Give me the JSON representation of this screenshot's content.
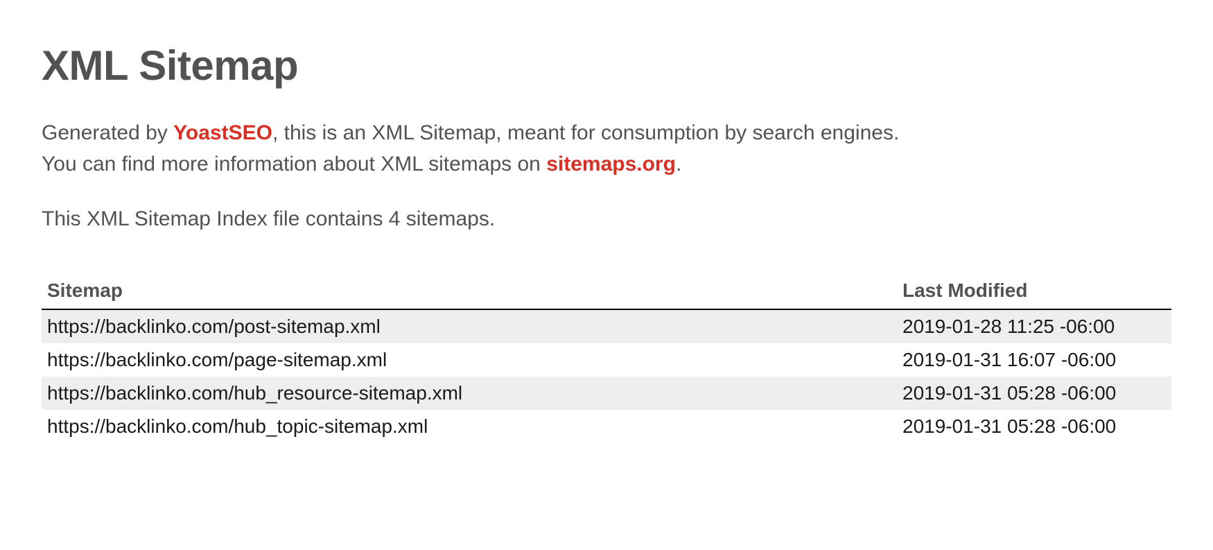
{
  "header": {
    "title": "XML Sitemap",
    "intro_prefix": "Generated by ",
    "yoast_link": "YoastSEO",
    "intro_mid1": ", this is an XML Sitemap, meant for consumption by search engines.",
    "intro_line2_prefix": "You can find more information about XML sitemaps on ",
    "sitemaps_link": "sitemaps.org",
    "intro_line2_suffix": ".",
    "count_line": "This XML Sitemap Index file contains 4 sitemaps."
  },
  "table": {
    "headers": {
      "sitemap": "Sitemap",
      "last_modified": "Last Modified"
    },
    "rows": [
      {
        "url": "https://backlinko.com/post-sitemap.xml",
        "modified": "2019-01-28 11:25 -06:00"
      },
      {
        "url": "https://backlinko.com/page-sitemap.xml",
        "modified": "2019-01-31 16:07 -06:00"
      },
      {
        "url": "https://backlinko.com/hub_resource-sitemap.xml",
        "modified": "2019-01-31 05:28 -06:00"
      },
      {
        "url": "https://backlinko.com/hub_topic-sitemap.xml",
        "modified": "2019-01-31 05:28 -06:00"
      }
    ]
  }
}
